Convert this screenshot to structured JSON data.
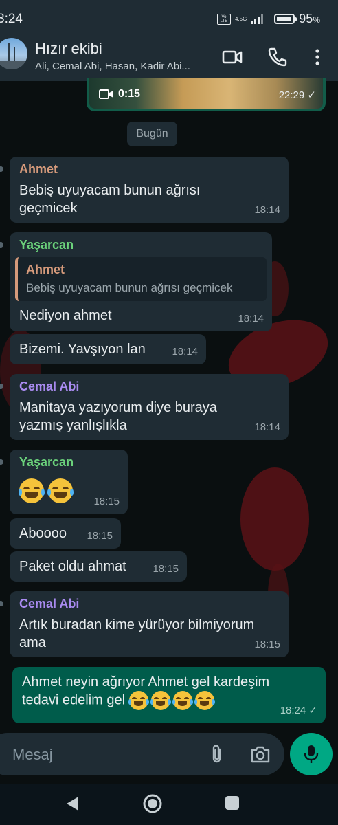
{
  "status_bar": {
    "time": "3:24",
    "network_badge": "Vo LTE",
    "network_type": "4.5G",
    "battery_percent": "95",
    "battery_unit": "%"
  },
  "header": {
    "title": "Hızır ekibi",
    "members": "Ali, Cemal Abi, Hasan, Kadir Abi...",
    "icons": [
      "video-call-icon",
      "voice-call-icon",
      "more-options-icon"
    ]
  },
  "video_message": {
    "duration": "0:15",
    "time": "22:29"
  },
  "date_chip": "Bugün",
  "messages": [
    {
      "sender": "Ahmet",
      "sender_color": "#d59a7b",
      "lines": [
        "Bebiş uyuyacam bunun ağrısı",
        "geçmicek"
      ],
      "time": "18:14"
    },
    {
      "sender": "Yaşarcan",
      "sender_color": "#6bd27b",
      "quote_sender": "Ahmet",
      "quote_text": "Bebiş uyuyacam bunun ağrısı geçmicek",
      "text": "Nediyon ahmet",
      "time": "18:14"
    },
    {
      "text": "Bizemi. Yavşıyon lan",
      "time": "18:14"
    },
    {
      "sender": "Cemal Abi",
      "sender_color": "#a98bf0",
      "lines": [
        "Manitaya yazıyorum diye buraya",
        "yazmış yanlışlıkla"
      ],
      "time": "18:14"
    },
    {
      "sender": "Yaşarcan",
      "sender_color": "#6bd27b",
      "emoji": "😂😂",
      "time": "18:15"
    },
    {
      "text": "Aboooo",
      "time": "18:15"
    },
    {
      "text": "Paket oldu ahmat",
      "time": "18:15"
    },
    {
      "sender": "Cemal Abi",
      "sender_color": "#a98bf0",
      "lines": [
        "Artık buradan kime yürüyor bilmiyorum",
        "ama"
      ],
      "time": "18:15"
    },
    {
      "outgoing": true,
      "lines": [
        "Ahmet neyin ağrıyor Ahmet gel kardeşim",
        "tedavi edelim gel"
      ],
      "emoji": "😂😂😂😂",
      "time": "18:24"
    }
  ],
  "input": {
    "placeholder": "Mesaj"
  },
  "colors": {
    "header_bg": "#1f2c34",
    "incoming_bubble": "#1f2c34",
    "outgoing_bubble": "#005c4b",
    "accent": "#00a884"
  }
}
